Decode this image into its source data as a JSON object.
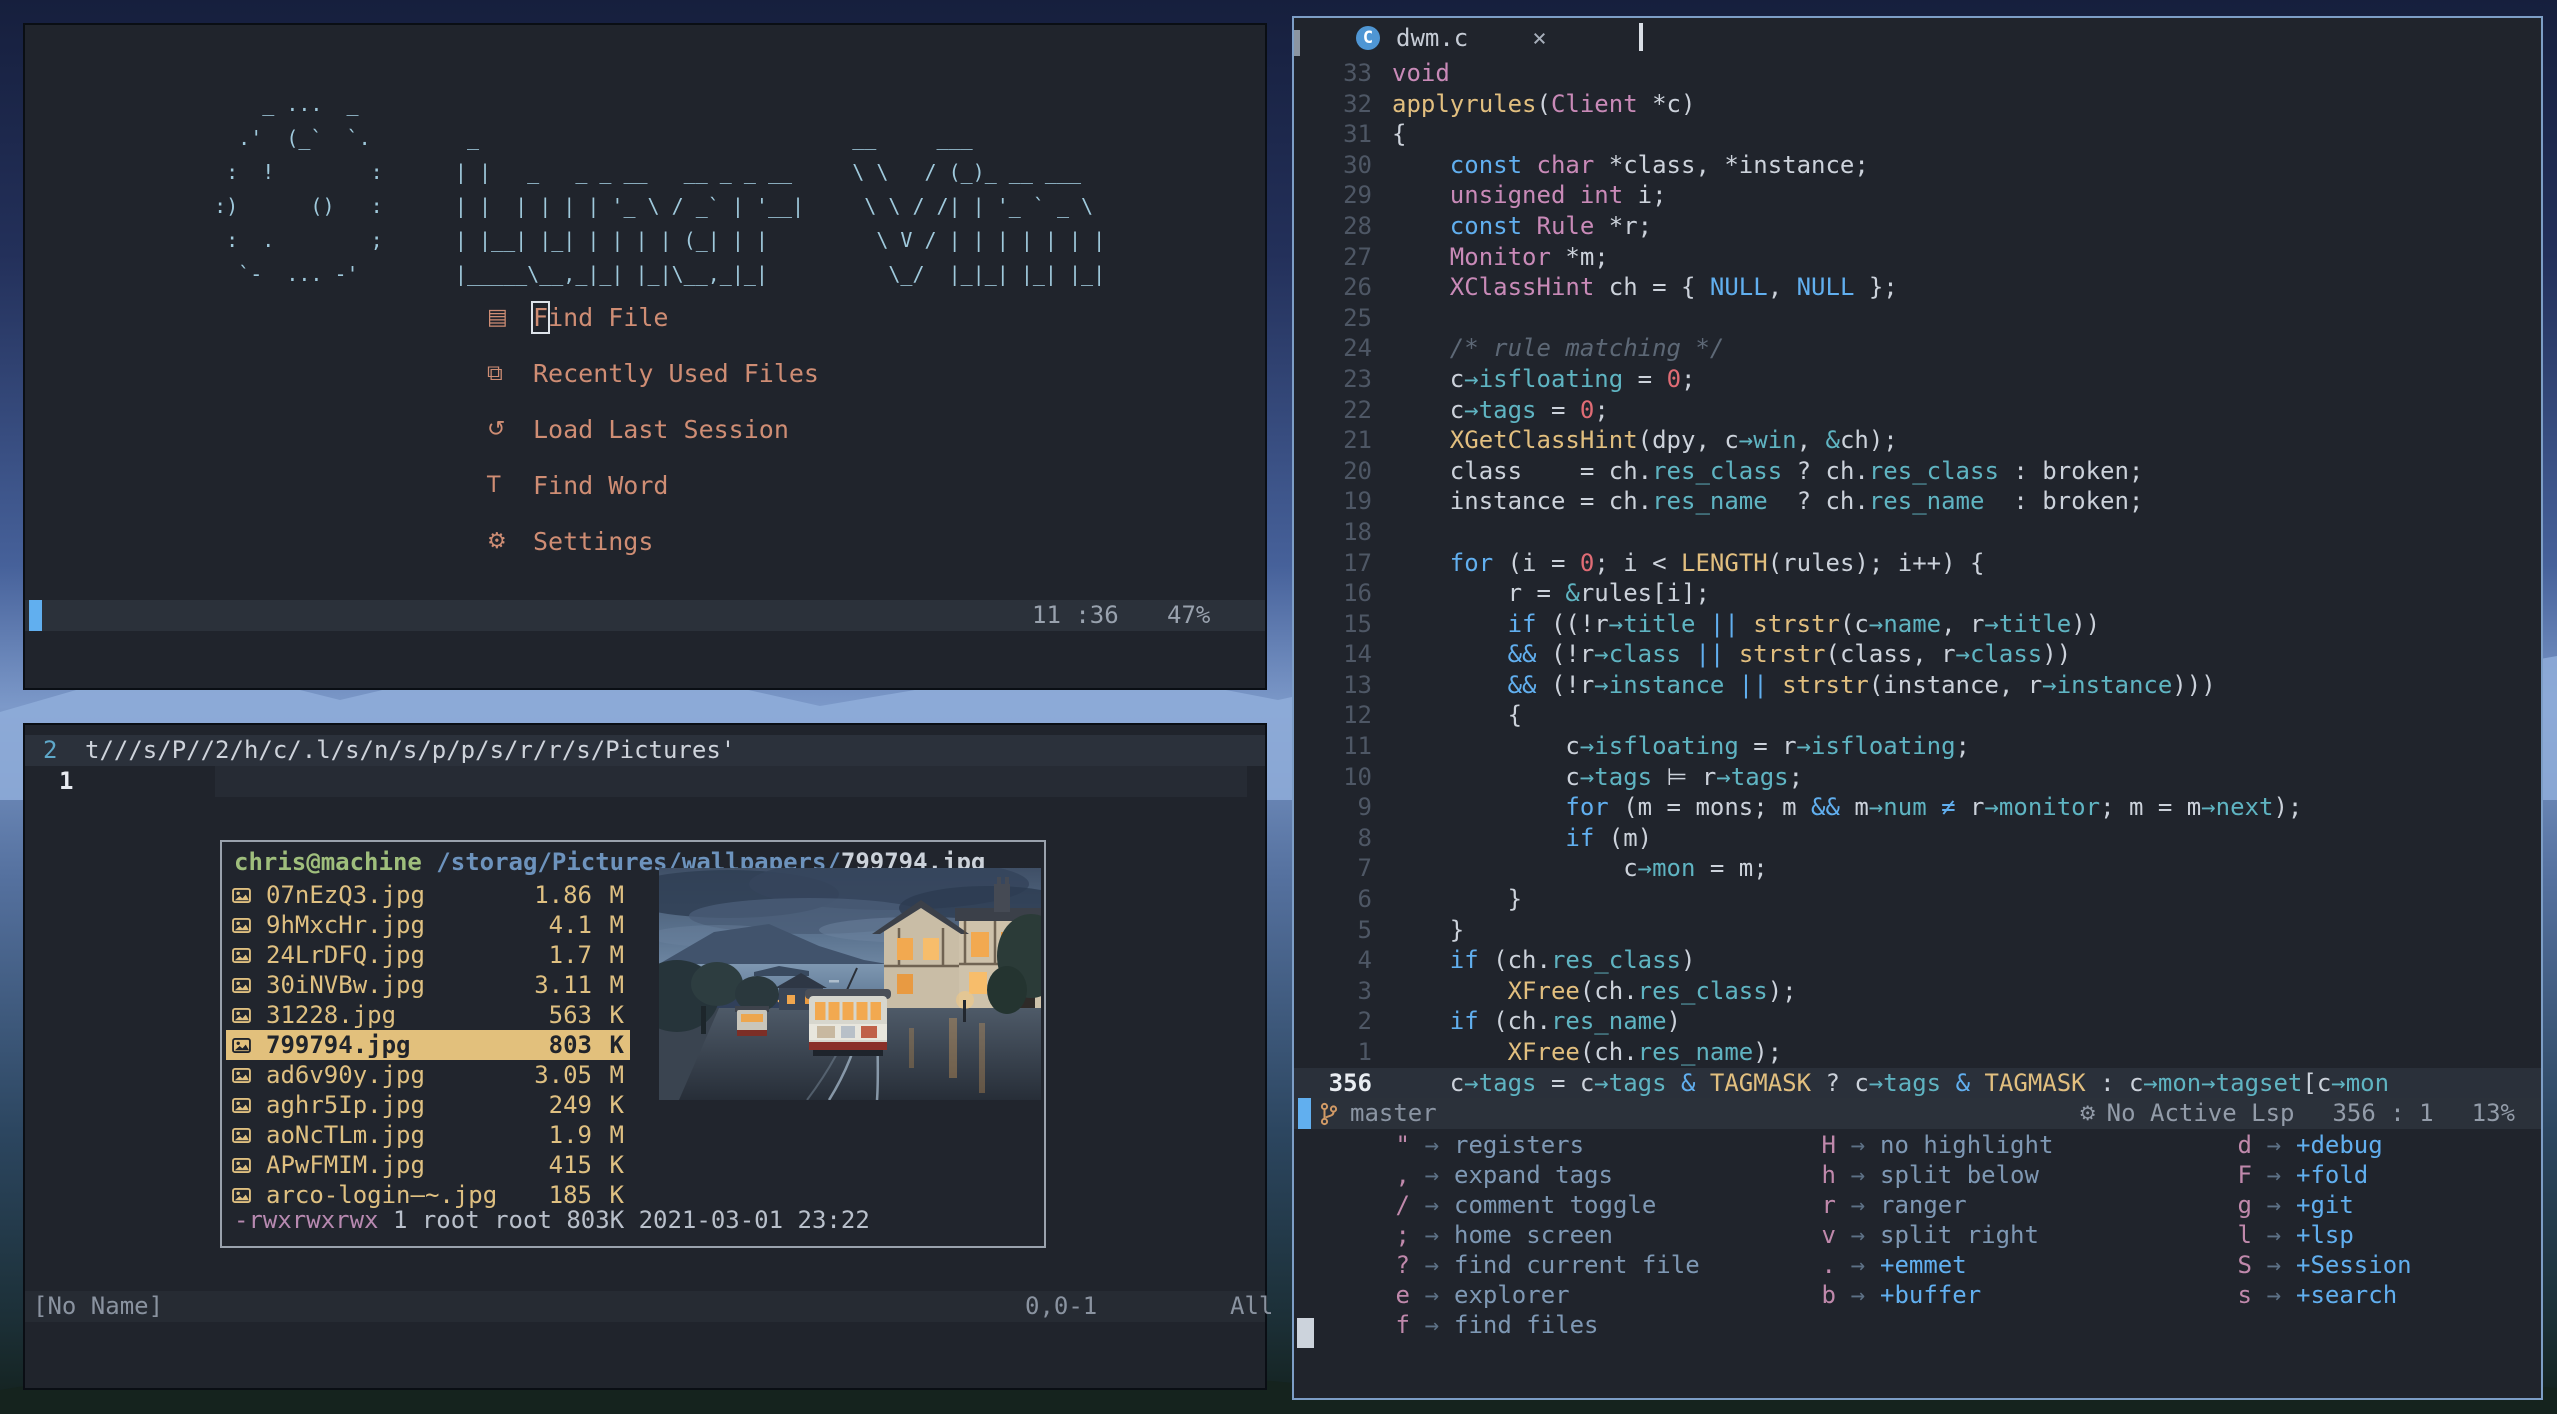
{
  "colors": {
    "accent": "#61afef",
    "salmon": "#cf8d74",
    "logo": "#9fc9dc",
    "tan": "#e2c07c",
    "fileyellow": "#dfc081",
    "orange": "#d19a66",
    "pink": "#c98ab8",
    "yellow": "#e2bf7f",
    "blue": "#61afef",
    "teal": "#5fb4c2",
    "red": "#e06c75",
    "purple": "#b789b0"
  },
  "dashboard": {
    "logo_ascii": "      _ ...  _\n    .'  (_`  `.        _                               __     ___\n   :  !        :      | |   _   _ _ __   __ _ _ __     \\ \\   / (_)_ __ ___\n  :)      ()   :      | |  | | | | '_ \\ / _` | '__|     \\ \\ / /| | '_ ` _ \\\n   :  .        ;      | |__| |_| | | | | (_| | |         \\ V / | | | | | | |\n    `-  ... -'        |_____\\__,_|_| |_|\\__,_|_|          \\_/  |_|_| |_| |_|",
    "menu": [
      {
        "id": "find-file",
        "icon": "file",
        "label": "Find File",
        "cursor": true
      },
      {
        "id": "recent-files",
        "icon": "copy",
        "label": "Recently Used Files"
      },
      {
        "id": "load-session",
        "icon": "reload",
        "label": "Load Last Session"
      },
      {
        "id": "find-word",
        "icon": "letter",
        "label": "Find Word"
      },
      {
        "id": "settings",
        "icon": "gear",
        "label": "Settings"
      }
    ],
    "statusline": {
      "position": "11 :36",
      "percent": "47%"
    }
  },
  "scratch": {
    "line2_num": "2",
    "line2_text": "t///s/P//2/h/c/.l/s/n/s/p/p/s/r/r/s/Pictures'",
    "line1_num": "1",
    "status": {
      "name": "[No Name]",
      "ruler": "0,0-1",
      "scroll": "All"
    }
  },
  "picker": {
    "header": {
      "user": "chris@machine",
      "path": " /storag/Pictures/wallpapers/",
      "file": "799794.jpg"
    },
    "files": [
      {
        "name": "07nEzQ3.jpg",
        "size": "1.86",
        "unit": "M"
      },
      {
        "name": "9hMxcHr.jpg",
        "size": "4.1",
        "unit": "M"
      },
      {
        "name": "24LrDFQ.jpg",
        "size": "1.7",
        "unit": "M"
      },
      {
        "name": "30iNVBw.jpg",
        "size": "3.11",
        "unit": "M"
      },
      {
        "name": "31228.jpg",
        "size": "563",
        "unit": "K"
      },
      {
        "name": "799794.jpg",
        "size": "803",
        "unit": "K",
        "selected": true
      },
      {
        "name": "ad6v90y.jpg",
        "size": "3.05",
        "unit": "M"
      },
      {
        "name": "aghr5Ip.jpg",
        "size": "249",
        "unit": "K"
      },
      {
        "name": "aoNcTLm.jpg",
        "size": "1.9",
        "unit": "M"
      },
      {
        "name": "APwFMIM.jpg",
        "size": "415",
        "unit": "K"
      },
      {
        "name": "arco-login—~.jpg",
        "size": "185",
        "unit": "K"
      }
    ],
    "footer": {
      "perms": "-rwxrwxrwx",
      "info": " 1 root root 803K 2021-03-01 23:22"
    }
  },
  "editor": {
    "tab": {
      "icon_letter": "C",
      "label": "dwm.c",
      "close": "×"
    },
    "lines": [
      {
        "num": "33",
        "spans": [
          [
            "k",
            "void"
          ]
        ]
      },
      {
        "num": "32",
        "spans": [
          [
            "f",
            "applyrules"
          ],
          [
            "t",
            "("
          ],
          [
            "k",
            "Client"
          ],
          [
            "t",
            " *c)"
          ]
        ]
      },
      {
        "num": "31",
        "spans": [
          [
            "t",
            "{"
          ]
        ]
      },
      {
        "num": "30",
        "spans": [
          [
            "t",
            "    "
          ],
          [
            "b",
            "const"
          ],
          [
            "t",
            " "
          ],
          [
            "k",
            "char"
          ],
          [
            "t",
            " *class, *instance;"
          ]
        ]
      },
      {
        "num": "29",
        "spans": [
          [
            "t",
            "    "
          ],
          [
            "k",
            "unsigned"
          ],
          [
            "t",
            " "
          ],
          [
            "k",
            "int"
          ],
          [
            "t",
            " i;"
          ]
        ]
      },
      {
        "num": "28",
        "spans": [
          [
            "t",
            "    "
          ],
          [
            "b",
            "const"
          ],
          [
            "t",
            " "
          ],
          [
            "k",
            "Rule"
          ],
          [
            "t",
            " *r;"
          ]
        ]
      },
      {
        "num": "27",
        "spans": [
          [
            "t",
            "    "
          ],
          [
            "k",
            "Monitor"
          ],
          [
            "t",
            " *m;"
          ]
        ]
      },
      {
        "num": "26",
        "spans": [
          [
            "t",
            "    "
          ],
          [
            "k",
            "XClassHint"
          ],
          [
            "t",
            " ch = { "
          ],
          [
            "b",
            "NULL"
          ],
          [
            "t",
            ", "
          ],
          [
            "b",
            "NULL"
          ],
          [
            "t",
            " };"
          ]
        ]
      },
      {
        "num": "25",
        "spans": []
      },
      {
        "num": "24",
        "spans": [
          [
            "t",
            "    "
          ],
          [
            "c",
            "/* rule matching */"
          ]
        ]
      },
      {
        "num": "23",
        "spans": [
          [
            "t",
            "    c"
          ],
          [
            "m",
            "→isfloating"
          ],
          [
            "t",
            " = "
          ],
          [
            "n",
            "0"
          ],
          [
            "t",
            ";"
          ]
        ]
      },
      {
        "num": "22",
        "spans": [
          [
            "t",
            "    c"
          ],
          [
            "m",
            "→tags"
          ],
          [
            "t",
            " = "
          ],
          [
            "n",
            "0"
          ],
          [
            "t",
            ";"
          ]
        ]
      },
      {
        "num": "21",
        "spans": [
          [
            "t",
            "    "
          ],
          [
            "f",
            "XGetClassHint"
          ],
          [
            "t",
            "(dpy, c"
          ],
          [
            "m",
            "→win"
          ],
          [
            "t",
            ", "
          ],
          [
            "m",
            "&"
          ],
          [
            "t",
            "ch);"
          ]
        ]
      },
      {
        "num": "20",
        "spans": [
          [
            "t",
            "    class    = ch."
          ],
          [
            "m",
            "res_class"
          ],
          [
            "t",
            " ? ch."
          ],
          [
            "m",
            "res_class"
          ],
          [
            "t",
            " : broken;"
          ]
        ]
      },
      {
        "num": "19",
        "spans": [
          [
            "t",
            "    instance = ch."
          ],
          [
            "m",
            "res_name"
          ],
          [
            "t",
            "  ? ch."
          ],
          [
            "m",
            "res_name"
          ],
          [
            "t",
            "  : broken;"
          ]
        ]
      },
      {
        "num": "18",
        "spans": []
      },
      {
        "num": "17",
        "spans": [
          [
            "t",
            "    "
          ],
          [
            "b",
            "for"
          ],
          [
            "t",
            " (i = "
          ],
          [
            "n",
            "0"
          ],
          [
            "t",
            "; i < "
          ],
          [
            "f",
            "LENGTH"
          ],
          [
            "t",
            "(rules); i++) {"
          ]
        ]
      },
      {
        "num": "16",
        "spans": [
          [
            "t",
            "        r = "
          ],
          [
            "m",
            "&"
          ],
          [
            "t",
            "rules[i];"
          ]
        ]
      },
      {
        "num": "15",
        "spans": [
          [
            "t",
            "        "
          ],
          [
            "b",
            "if"
          ],
          [
            "t",
            " ((!r"
          ],
          [
            "m",
            "→title"
          ],
          [
            "t",
            " "
          ],
          [
            "b",
            "||"
          ],
          [
            "t",
            " "
          ],
          [
            "f",
            "strstr"
          ],
          [
            "t",
            "(c"
          ],
          [
            "m",
            "→name"
          ],
          [
            "t",
            ", r"
          ],
          [
            "m",
            "→title"
          ],
          [
            "t",
            "))"
          ]
        ]
      },
      {
        "num": "14",
        "spans": [
          [
            "t",
            "        "
          ],
          [
            "b",
            "&&"
          ],
          [
            "t",
            " (!r"
          ],
          [
            "m",
            "→class"
          ],
          [
            "t",
            " "
          ],
          [
            "b",
            "||"
          ],
          [
            "t",
            " "
          ],
          [
            "f",
            "strstr"
          ],
          [
            "t",
            "(class, r"
          ],
          [
            "m",
            "→class"
          ],
          [
            "t",
            "))"
          ]
        ]
      },
      {
        "num": "13",
        "spans": [
          [
            "t",
            "        "
          ],
          [
            "b",
            "&&"
          ],
          [
            "t",
            " (!r"
          ],
          [
            "m",
            "→instance"
          ],
          [
            "t",
            " "
          ],
          [
            "b",
            "||"
          ],
          [
            "t",
            " "
          ],
          [
            "f",
            "strstr"
          ],
          [
            "t",
            "(instance, r"
          ],
          [
            "m",
            "→instance"
          ],
          [
            "t",
            ")))"
          ]
        ]
      },
      {
        "num": "12",
        "spans": [
          [
            "t",
            "        {"
          ]
        ]
      },
      {
        "num": "11",
        "spans": [
          [
            "t",
            "            c"
          ],
          [
            "m",
            "→isfloating"
          ],
          [
            "t",
            " = r"
          ],
          [
            "m",
            "→isfloating"
          ],
          [
            "t",
            ";"
          ]
        ]
      },
      {
        "num": "10",
        "spans": [
          [
            "t",
            "            c"
          ],
          [
            "m",
            "→tags"
          ],
          [
            "t",
            " ⊨ r"
          ],
          [
            "m",
            "→tags"
          ],
          [
            "t",
            ";"
          ]
        ]
      },
      {
        "num": "9",
        "spans": [
          [
            "t",
            "            "
          ],
          [
            "b",
            "for"
          ],
          [
            "t",
            " (m = mons; m "
          ],
          [
            "b",
            "&&"
          ],
          [
            "t",
            " m"
          ],
          [
            "m",
            "→num"
          ],
          [
            "t",
            " "
          ],
          [
            "b",
            "≠"
          ],
          [
            "t",
            " r"
          ],
          [
            "m",
            "→monitor"
          ],
          [
            "t",
            "; m = m"
          ],
          [
            "m",
            "→next"
          ],
          [
            "t",
            ");"
          ]
        ]
      },
      {
        "num": "8",
        "spans": [
          [
            "t",
            "            "
          ],
          [
            "b",
            "if"
          ],
          [
            "t",
            " (m)"
          ]
        ]
      },
      {
        "num": "7",
        "spans": [
          [
            "t",
            "                c"
          ],
          [
            "m",
            "→mon"
          ],
          [
            "t",
            " = m;"
          ]
        ]
      },
      {
        "num": "6",
        "spans": [
          [
            "t",
            "        }"
          ]
        ]
      },
      {
        "num": "5",
        "spans": [
          [
            "t",
            "    }"
          ]
        ]
      },
      {
        "num": "4",
        "spans": [
          [
            "t",
            "    "
          ],
          [
            "b",
            "if"
          ],
          [
            "t",
            " (ch."
          ],
          [
            "m",
            "res_class"
          ],
          [
            "t",
            ")"
          ]
        ]
      },
      {
        "num": "3",
        "spans": [
          [
            "t",
            "        "
          ],
          [
            "f",
            "XFree"
          ],
          [
            "t",
            "(ch."
          ],
          [
            "m",
            "res_class"
          ],
          [
            "t",
            ");"
          ]
        ]
      },
      {
        "num": "2",
        "spans": [
          [
            "t",
            "    "
          ],
          [
            "b",
            "if"
          ],
          [
            "t",
            " (ch."
          ],
          [
            "m",
            "res_name"
          ],
          [
            "t",
            ")"
          ]
        ]
      },
      {
        "num": "1",
        "spans": [
          [
            "t",
            "        "
          ],
          [
            "f",
            "XFree"
          ],
          [
            "t",
            "(ch."
          ],
          [
            "m",
            "res_name"
          ],
          [
            "t",
            ");"
          ]
        ]
      },
      {
        "num": "356",
        "current": true,
        "spans": [
          [
            "t",
            "    c"
          ],
          [
            "m",
            "→tags"
          ],
          [
            "t",
            " = c"
          ],
          [
            "m",
            "→tags"
          ],
          [
            "t",
            " "
          ],
          [
            "b",
            "&"
          ],
          [
            "t",
            " "
          ],
          [
            "f",
            "TAGMASK"
          ],
          [
            "t",
            " ? c"
          ],
          [
            "m",
            "→tags"
          ],
          [
            "t",
            " "
          ],
          [
            "b",
            "&"
          ],
          [
            "t",
            " "
          ],
          [
            "f",
            "TAGMASK"
          ],
          [
            "t",
            " : c"
          ],
          [
            "m",
            "→mon"
          ],
          [
            "m",
            "→tagset"
          ],
          [
            "t",
            "[c"
          ],
          [
            "m",
            "→mon"
          ]
        ]
      }
    ],
    "statusline": {
      "branch": "master",
      "lsp": "No Active Lsp",
      "position": "356 : 1",
      "percent": "13%"
    },
    "whichkey": {
      "arrow": "→",
      "columns": [
        [
          {
            "key": "\"",
            "desc": "registers"
          },
          {
            "key": ",",
            "desc": "expand tags"
          },
          {
            "key": "/",
            "desc": "comment toggle"
          },
          {
            "key": ";",
            "desc": "home screen"
          },
          {
            "key": "?",
            "desc": "find current file"
          },
          {
            "key": "e",
            "desc": "explorer"
          },
          {
            "key": "f",
            "desc": "find files"
          }
        ],
        [
          {
            "key": "H",
            "desc": "no highlight"
          },
          {
            "key": "h",
            "desc": "split below"
          },
          {
            "key": "r",
            "desc": "ranger"
          },
          {
            "key": "v",
            "desc": "split right"
          },
          {
            "key": ".",
            "desc": "+emmet",
            "group": true
          },
          {
            "key": "b",
            "desc": "+buffer",
            "group": true
          }
        ],
        [
          {
            "key": "d",
            "desc": "+debug",
            "group": true
          },
          {
            "key": "F",
            "desc": "+fold",
            "group": true
          },
          {
            "key": "g",
            "desc": "+git",
            "group": true
          },
          {
            "key": "l",
            "desc": "+lsp",
            "group": true
          },
          {
            "key": "S",
            "desc": "+Session",
            "group": true
          },
          {
            "key": "s",
            "desc": "+search",
            "group": true
          }
        ]
      ]
    }
  }
}
